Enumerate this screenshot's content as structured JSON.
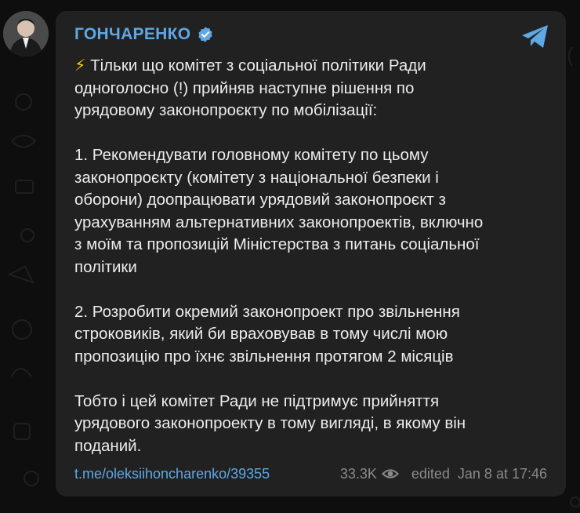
{
  "colors": {
    "accent": "#5fa8e3",
    "bubble": "#212121",
    "text": "#ececec",
    "meta": "#8a8a8a",
    "bolt": "#f5c518"
  },
  "channel": {
    "name": "ГОНЧАРЕНКО",
    "verified_icon": "verified-badge-icon",
    "avatar_icon": "channel-avatar"
  },
  "message": {
    "emoji": "⚡",
    "paragraph1": " Тільки що комітет з соціальної політики Ради\nодноголосно (!) прийняв наступне рішення по\nурядовому законопроєкту по мобілізації:",
    "paragraph2": "1. Рекомендувати головному комітету по цьому\nзаконопроєкту (комітету з національної безпеки і\nоборони) доопрацювати урядовий законопроєкт з\nурахуванням альтернативних законопроектів, включно\nз моїм та пропозицій Міністерства з питань соціальної\nполітики",
    "paragraph3": "2. Розробити окремий законопроект про звільнення\nстроковиків, який би враховував в тому числі мою\nпропозицію про їхнє звільнення протягом 2 місяців",
    "paragraph4": "Тобто і цей комітет Ради не підтримує прийняття\nурядового законопроекту в тому вигляді, в якому він\nподаний."
  },
  "footer": {
    "link": "t.me/oleksiihoncharenko/39355",
    "views": "33.3K",
    "views_icon": "eye-icon",
    "edited": "edited",
    "datetime": "Jan 8 at 17:46"
  },
  "share_icon": "telegram-share-icon"
}
